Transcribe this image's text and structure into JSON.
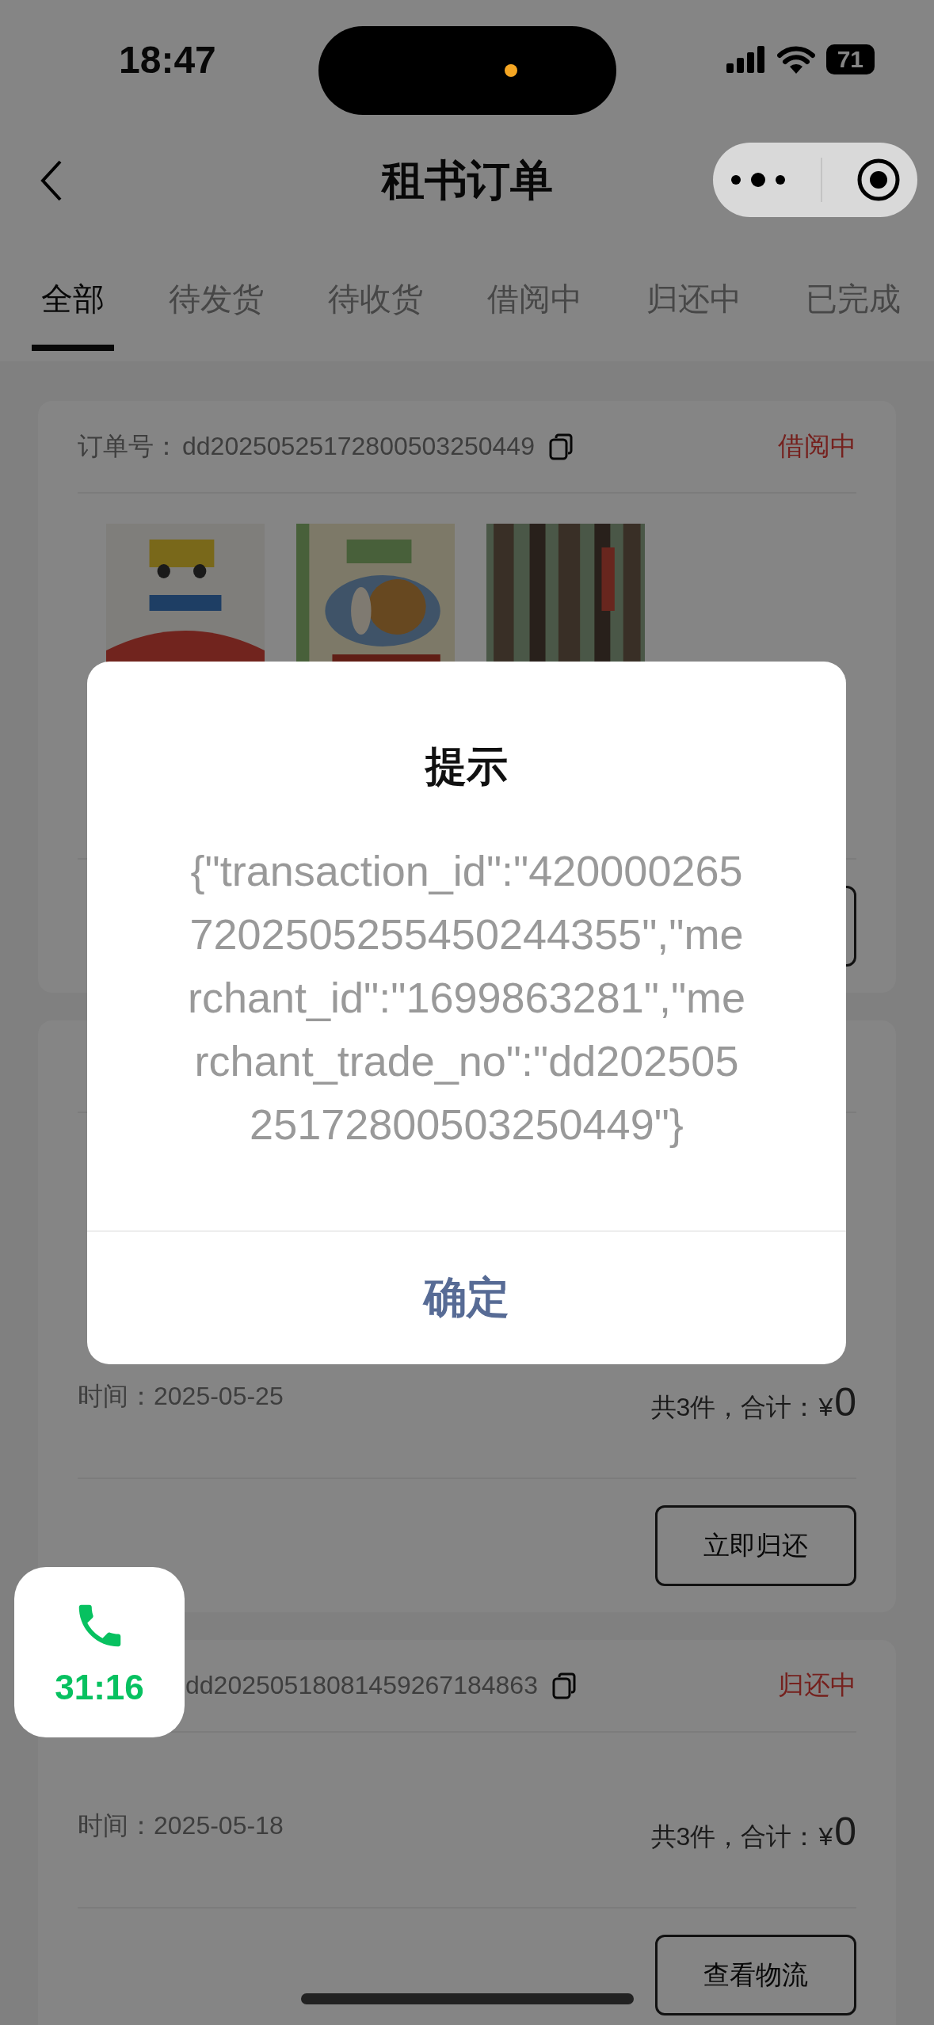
{
  "status_bar": {
    "time": "18:47",
    "battery": "71"
  },
  "nav": {
    "title": "租书订单"
  },
  "tabs": [
    {
      "label": "全部",
      "selected": true
    },
    {
      "label": "待发货",
      "selected": false
    },
    {
      "label": "待收货",
      "selected": false
    },
    {
      "label": "借阅中",
      "selected": false
    },
    {
      "label": "归还中",
      "selected": false
    },
    {
      "label": "已完成",
      "selected": false
    }
  ],
  "orders": [
    {
      "kind": "books",
      "order_label": "订单号：",
      "order_no": "dd20250525172800503250449",
      "status": "借阅中"
    },
    {
      "kind": "books",
      "time": "时间：2025-05-25",
      "summary": "共3件，合计：",
      "currency": "¥",
      "amount": "0",
      "button": "立即归还"
    },
    {
      "kind": "plain",
      "order_no": "dd20250518081459267184863",
      "status": "归还中",
      "time": "时间：2025-05-18",
      "summary": "共3件，合计：",
      "currency": "¥",
      "amount": "0",
      "button": "查看物流"
    }
  ],
  "dialog": {
    "title": "提示",
    "message": "{\"transaction_id\":\"4200002657202505255450244355\",\"merchant_id\":\"1699863281\",\"merchant_trade_no\":\"dd20250525172800503250449\"}",
    "confirm": "确定"
  },
  "call_widget": {
    "duration": "31:16"
  }
}
